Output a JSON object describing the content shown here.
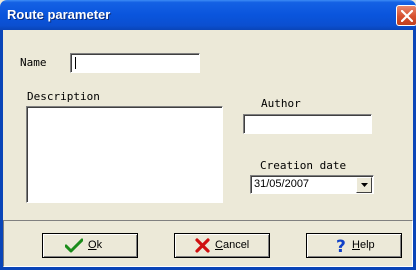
{
  "window": {
    "title": "Route parameter"
  },
  "form": {
    "name_label": "Name",
    "name_value": "",
    "description_label": "Description",
    "description_value": "",
    "author_label": "Author",
    "author_value": "",
    "creation_date_label": "Creation date",
    "creation_date_value": "31/05/2007"
  },
  "buttons": {
    "ok_mnemonic": "O",
    "ok_rest": "k",
    "cancel_mnemonic": "C",
    "cancel_rest": "ancel",
    "help_mnemonic": "H",
    "help_rest": "elp"
  },
  "icons": {
    "ok": "green-checkmark-icon",
    "cancel": "red-x-icon",
    "help": "blue-question-mark-icon",
    "close": "close-icon",
    "dropdown": "chevron-down-icon"
  },
  "colors": {
    "titlebar": "#0a55dd",
    "close": "#d6502e",
    "dialog": "#ece9d8"
  }
}
